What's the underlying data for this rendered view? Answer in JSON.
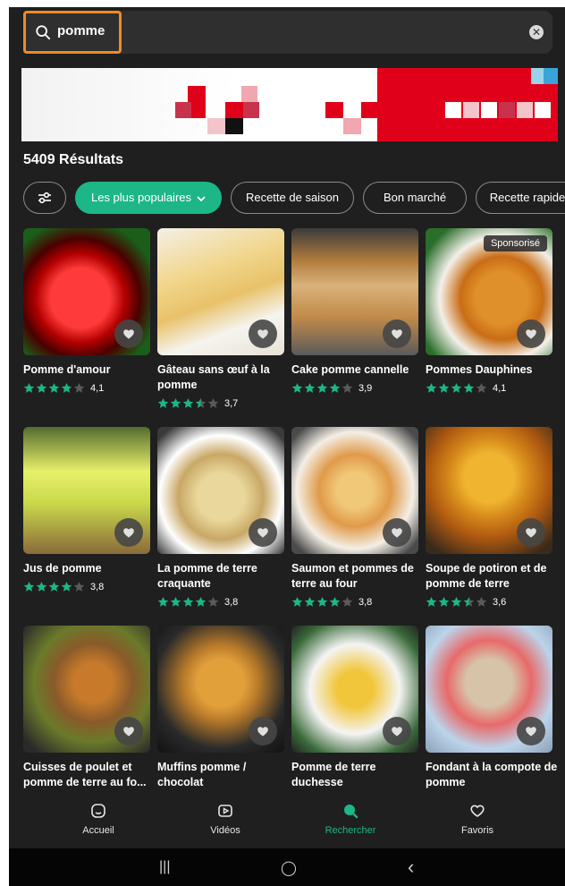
{
  "search": {
    "query": "pomme",
    "icon": "search-icon",
    "clear_icon": "close-icon",
    "clear_glyph": "✕"
  },
  "results": {
    "count_label": "5409 Résultats"
  },
  "filters": {
    "settings_icon": "sliders-icon",
    "chips": [
      {
        "label": "Les plus populaires",
        "active": true
      },
      {
        "label": "Recette de saison",
        "active": false
      },
      {
        "label": "Bon marché",
        "active": false
      },
      {
        "label": "Recette rapide",
        "active": false
      }
    ]
  },
  "colors": {
    "accent": "#1cb687",
    "background": "#1f1f1f",
    "highlight": "#f08a24",
    "banner_red": "#e1001a"
  },
  "recipes": [
    {
      "title": "Pomme d'amour",
      "rating": "4,1",
      "stars": 4,
      "sponsored": ""
    },
    {
      "title": "Gâteau sans œuf à la pomme",
      "rating": "3,7",
      "stars": 3.5,
      "sponsored": ""
    },
    {
      "title": "Cake pomme cannelle",
      "rating": "3,9",
      "stars": 4,
      "sponsored": ""
    },
    {
      "title": "Pommes Dauphines",
      "rating": "4,1",
      "stars": 4,
      "sponsored": "Sponsorisé"
    },
    {
      "title": "Jus de pomme",
      "rating": "3,8",
      "stars": 4,
      "sponsored": ""
    },
    {
      "title": "La pomme de terre craquante",
      "rating": "3,8",
      "stars": 4,
      "sponsored": ""
    },
    {
      "title": "Saumon et pommes de terre au four",
      "rating": "3,8",
      "stars": 4,
      "sponsored": ""
    },
    {
      "title": "Soupe de potiron et de pomme de terre",
      "rating": "3,6",
      "stars": 3.5,
      "sponsored": ""
    },
    {
      "title": "Cuisses de poulet et pomme de terre au fo...",
      "rating": "",
      "stars": 0,
      "sponsored": ""
    },
    {
      "title": "Muffins pomme / chocolat",
      "rating": "",
      "stars": 0,
      "sponsored": ""
    },
    {
      "title": "Pomme de terre duchesse",
      "rating": "",
      "stars": 0,
      "sponsored": ""
    },
    {
      "title": "Fondant à la compote de pomme",
      "rating": "",
      "stars": 0,
      "sponsored": ""
    }
  ],
  "nav": {
    "items": [
      {
        "label": "Accueil",
        "icon": "home-icon",
        "active": false
      },
      {
        "label": "Vidéos",
        "icon": "video-icon",
        "active": false
      },
      {
        "label": "Rechercher",
        "icon": "search-icon",
        "active": true
      },
      {
        "label": "Favoris",
        "icon": "heart-icon",
        "active": false
      }
    ]
  },
  "system": {
    "recents": "|||",
    "home": "◯",
    "back": "‹"
  }
}
